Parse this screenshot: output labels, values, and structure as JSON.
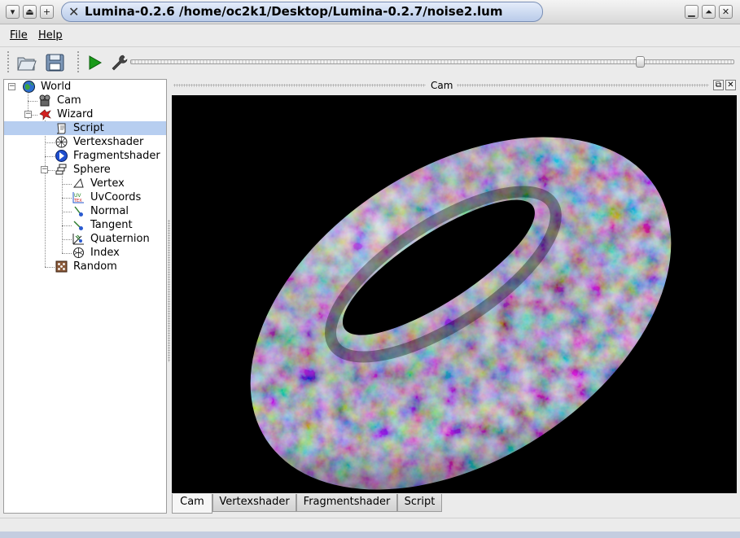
{
  "window": {
    "title": "Lumina-0.2.6 /home/oc2k1/Desktop/Lumina-0.2.7/noise2.lum",
    "controls_left": [
      "menu-icon",
      "shade-icon",
      "pin-icon"
    ],
    "controls_right": [
      "minimize-icon",
      "maximize-icon",
      "close-icon"
    ]
  },
  "menu": {
    "file": "File",
    "help": "Help"
  },
  "toolbar": {
    "tools": [
      "open-folder-icon",
      "save-disk-icon",
      "play-icon",
      "wrench-icon"
    ],
    "slider_value": 0.85
  },
  "tree": {
    "items": [
      {
        "label": "World",
        "icon": "globe-icon"
      },
      {
        "label": "Cam",
        "icon": "camera-icon"
      },
      {
        "label": "Wizard",
        "icon": "wizard-icon"
      },
      {
        "label": "Script",
        "icon": "scroll-icon",
        "selected": true
      },
      {
        "label": "Vertexshader",
        "icon": "vertexshader-icon"
      },
      {
        "label": "Fragmentshader",
        "icon": "fragmentshader-icon"
      },
      {
        "label": "Sphere",
        "icon": "stack-icon"
      },
      {
        "label": "Vertex",
        "icon": "vertex-icon"
      },
      {
        "label": "UvCoords",
        "icon": "uvcoords-icon"
      },
      {
        "label": "Normal",
        "icon": "normal-icon"
      },
      {
        "label": "Tangent",
        "icon": "tangent-icon"
      },
      {
        "label": "Quaternion",
        "icon": "quaternion-icon"
      },
      {
        "label": "Index",
        "icon": "index-icon"
      },
      {
        "label": "Random",
        "icon": "random-icon"
      }
    ]
  },
  "dock": {
    "title": "Cam"
  },
  "tabs": [
    {
      "label": "Cam",
      "active": true
    },
    {
      "label": "Vertexshader",
      "active": false
    },
    {
      "label": "Fragmentshader",
      "active": false
    },
    {
      "label": "Script",
      "active": false
    }
  ],
  "colors": {
    "selection": "#b7cef0",
    "viewport_bg": "#000000",
    "play_green": "#1a9a1a",
    "title_accent": "#b9cbe9"
  }
}
